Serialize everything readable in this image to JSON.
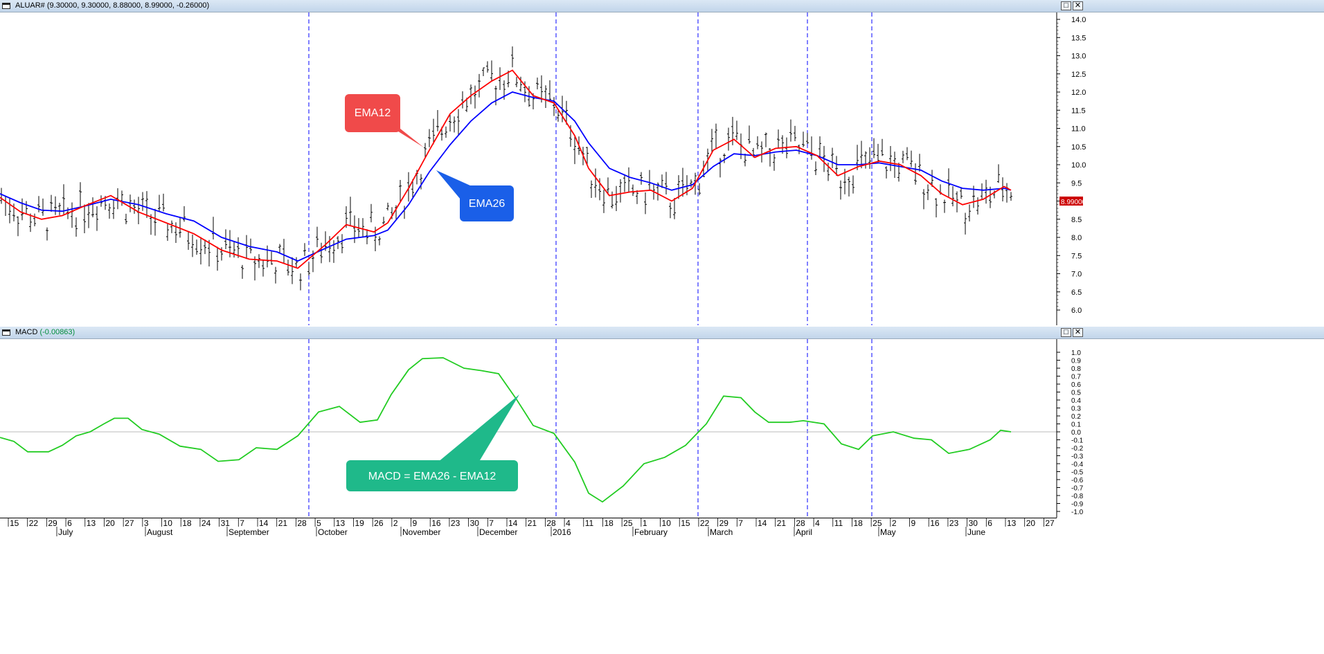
{
  "price_panel": {
    "title": "ALUAR#",
    "title_values": "(9.30000, 9.30000, 8.88000, 8.99000, -0.26000)",
    "last_price_tag": "8.99000",
    "callouts": [
      {
        "label": "EMA12",
        "color": "#f04a4a"
      },
      {
        "label": "EMA26",
        "color": "#1a5fe8"
      }
    ]
  },
  "macd_panel": {
    "title": "MACD",
    "title_value": "(-0.00863)",
    "callout": {
      "label": "MACD = EMA26 - EMA12",
      "color": "#1fb98a"
    }
  },
  "window_buttons": {
    "maximize": "□",
    "close": "✕"
  },
  "colors": {
    "ema12": "#ff0000",
    "ema26": "#0000ff",
    "macd": "#22cc22",
    "bars": "#000000",
    "divider": "#0000ff"
  },
  "chart_data": [
    {
      "type": "line",
      "title": "ALUAR#",
      "ylim": [
        5.7,
        14.1
      ],
      "y_ticks": [
        "6.0",
        "6.5",
        "7.0",
        "7.5",
        "8.0",
        "8.5",
        "9.0",
        "9.5",
        "10.0",
        "10.5",
        "11.0",
        "11.5",
        "12.0",
        "12.5",
        "13.0",
        "13.5",
        "14.0"
      ],
      "x_day_ticks": [
        "15",
        "22",
        "29",
        "6",
        "13",
        "20",
        "27",
        "3",
        "10",
        "18",
        "24",
        "31",
        "7",
        "14",
        "21",
        "28",
        "5",
        "13",
        "19",
        "26",
        "2",
        "9",
        "16",
        "23",
        "30",
        "7",
        "14",
        "21",
        "28",
        "4",
        "11",
        "18",
        "25",
        "1",
        "10",
        "15",
        "22",
        "29",
        "7",
        "14",
        "21",
        "28",
        "4",
        "11",
        "18",
        "25",
        "2",
        "9",
        "16",
        "23",
        "30",
        "6",
        "13",
        "20",
        "27"
      ],
      "x_month_labels": [
        "July",
        "August",
        "September",
        "October",
        "November",
        "December",
        "2016",
        "February",
        "March",
        "April",
        "May",
        "June"
      ],
      "index_range": [
        0,
        1530
      ],
      "series": [
        {
          "name": "EMA12",
          "x": [
            0,
            30,
            60,
            90,
            120,
            160,
            200,
            240,
            280,
            320,
            360,
            400,
            430,
            470,
            500,
            540,
            560,
            590,
            620,
            650,
            680,
            710,
            740,
            770,
            800,
            830,
            850,
            880,
            910,
            940,
            970,
            1000,
            1030,
            1060,
            1090,
            1120,
            1150,
            1180,
            1210,
            1240,
            1270,
            1300,
            1330,
            1360,
            1390,
            1420,
            1450,
            1460
          ],
          "y": [
            9.1,
            8.7,
            8.5,
            8.6,
            8.85,
            9.15,
            8.7,
            8.4,
            8.1,
            7.65,
            7.4,
            7.35,
            7.15,
            7.8,
            8.35,
            8.15,
            8.4,
            9.35,
            10.4,
            11.4,
            11.9,
            12.3,
            12.6,
            11.9,
            11.7,
            10.8,
            9.9,
            9.15,
            9.25,
            9.3,
            9.0,
            9.35,
            10.4,
            10.7,
            10.2,
            10.45,
            10.5,
            10.25,
            9.7,
            9.95,
            10.1,
            10.0,
            9.7,
            9.2,
            8.9,
            9.05,
            9.4,
            9.3
          ]
        },
        {
          "name": "EMA26",
          "x": [
            0,
            30,
            60,
            90,
            120,
            160,
            200,
            240,
            280,
            320,
            360,
            400,
            430,
            470,
            500,
            540,
            560,
            590,
            620,
            650,
            680,
            710,
            740,
            770,
            800,
            830,
            850,
            880,
            910,
            940,
            970,
            1000,
            1030,
            1060,
            1090,
            1120,
            1150,
            1180,
            1210,
            1240,
            1270,
            1300,
            1330,
            1360,
            1390,
            1420,
            1450,
            1460
          ],
          "y": [
            9.2,
            8.95,
            8.75,
            8.72,
            8.85,
            9.05,
            8.9,
            8.65,
            8.45,
            8.0,
            7.75,
            7.6,
            7.35,
            7.7,
            7.95,
            8.05,
            8.2,
            8.9,
            9.8,
            10.55,
            11.2,
            11.7,
            12.0,
            11.85,
            11.75,
            11.2,
            10.6,
            9.9,
            9.65,
            9.5,
            9.3,
            9.45,
            9.95,
            10.3,
            10.25,
            10.35,
            10.4,
            10.25,
            10.0,
            10.0,
            10.05,
            9.95,
            9.85,
            9.55,
            9.35,
            9.3,
            9.35,
            9.3
          ]
        }
      ]
    },
    {
      "type": "line",
      "title": "MACD",
      "ylim": [
        -1.05,
        1.05
      ],
      "y_ticks": [
        "1.0",
        "0.9",
        "0.8",
        "0.7",
        "0.6",
        "0.5",
        "0.4",
        "0.3",
        "0.2",
        "0.1",
        "0.0",
        "-0.1",
        "-0.2",
        "-0.3",
        "-0.4",
        "-0.5",
        "-0.6",
        "-0.7",
        "-0.8",
        "-0.9",
        "-1.0"
      ],
      "series": [
        {
          "name": "MACD",
          "x": [
            0,
            20,
            40,
            70,
            90,
            110,
            130,
            150,
            165,
            185,
            205,
            230,
            260,
            290,
            315,
            345,
            370,
            400,
            430,
            460,
            490,
            520,
            545,
            565,
            590,
            610,
            640,
            670,
            695,
            720,
            745,
            770,
            800,
            830,
            850,
            870,
            900,
            930,
            960,
            990,
            1020,
            1045,
            1070,
            1090,
            1110,
            1140,
            1160,
            1190,
            1215,
            1240,
            1260,
            1290,
            1320,
            1345,
            1370,
            1400,
            1430,
            1445,
            1460
          ],
          "y": [
            -0.07,
            -0.12,
            -0.25,
            -0.25,
            -0.17,
            -0.05,
            0.0,
            0.1,
            0.17,
            0.17,
            0.03,
            -0.03,
            -0.18,
            -0.22,
            -0.37,
            -0.35,
            -0.2,
            -0.22,
            -0.05,
            0.25,
            0.32,
            0.12,
            0.15,
            0.47,
            0.78,
            0.92,
            0.93,
            0.8,
            0.77,
            0.73,
            0.42,
            0.08,
            -0.02,
            -0.38,
            -0.77,
            -0.88,
            -0.68,
            -0.4,
            -0.32,
            -0.17,
            0.1,
            0.45,
            0.43,
            0.25,
            0.12,
            0.12,
            0.14,
            0.1,
            -0.15,
            -0.22,
            -0.05,
            0.0,
            -0.08,
            -0.1,
            -0.27,
            -0.22,
            -0.1,
            0.02,
            0.0
          ]
        }
      ]
    }
  ]
}
